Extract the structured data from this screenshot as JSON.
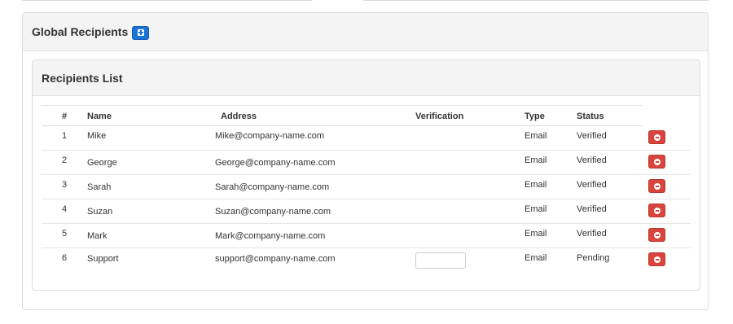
{
  "panel": {
    "title": "Global Recipients",
    "add_icon": "plus-square-icon"
  },
  "list": {
    "title": "Recipients List",
    "columns": [
      "#",
      "Name",
      "Address",
      "Verification",
      "Type",
      "Status"
    ],
    "rows": [
      {
        "num": "1",
        "name": "Mike",
        "address": "Mike@company-name.com",
        "type": "Email",
        "status": "Verified"
      },
      {
        "num": "2",
        "name": "George",
        "address": "George@company-name.com",
        "type": "Email",
        "status": "Verified"
      },
      {
        "num": "3",
        "name": "Sarah",
        "address": "Sarah@company-name.com",
        "type": "Email",
        "status": "Verified"
      },
      {
        "num": "4",
        "name": "Suzan",
        "address": "Suzan@company-name.com",
        "type": "Email",
        "status": "Verified"
      },
      {
        "num": "5",
        "name": "Mark",
        "address": "Mark@company-name.com",
        "type": "Email",
        "status": "Verified"
      },
      {
        "num": "6",
        "name": "Support",
        "address": "support@company-name.com",
        "type": "Email",
        "status": "Pending",
        "verification_input": ""
      }
    ],
    "delete_icon": "minus-circle-icon"
  },
  "colors": {
    "add_button": "#1a73d6",
    "delete_button": "#d9443c",
    "heading_bg": "#f4f4f4"
  }
}
